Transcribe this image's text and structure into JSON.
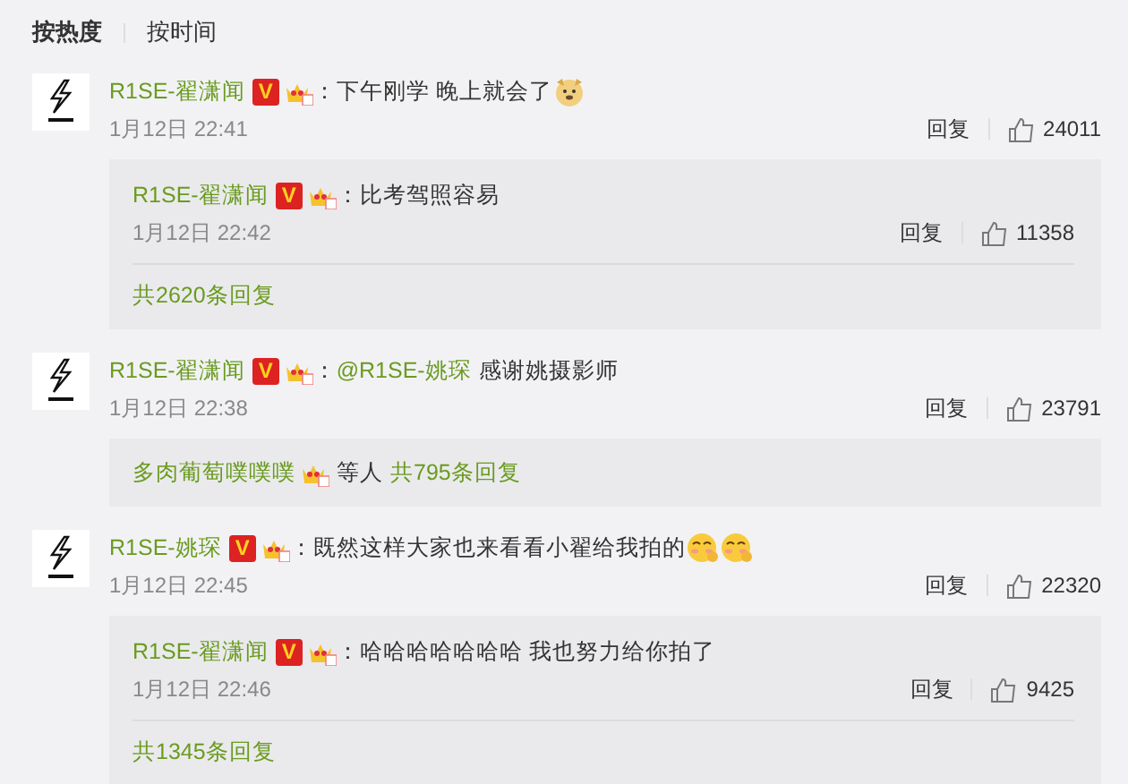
{
  "tabs": [
    {
      "label": "按热度",
      "selected": true
    },
    {
      "label": "按时间",
      "selected": false
    }
  ],
  "comments": [
    {
      "name": "R1SE-翟潇闻",
      "badge": "V",
      "colon": "：",
      "text": "下午刚学 晚上就会了",
      "emojis": [
        {
          "kind": "dog"
        }
      ],
      "time": "1月12日 22:41",
      "reply": "回复",
      "likes": "24011",
      "replies": [
        {
          "name": "R1SE-翟潇闻",
          "badge": "V",
          "colon": "：",
          "text": "比考驾照容易",
          "time": "1月12日 22:42",
          "reply": "回复",
          "likes": "11358"
        }
      ],
      "footer": {
        "kind": "total",
        "total": "共2620条回复"
      }
    },
    {
      "name": "R1SE-翟潇闻",
      "badge": "V",
      "colon": "：",
      "mention": "@R1SE-姚琛",
      "text": "感谢姚摄影师",
      "time": "1月12日 22:38",
      "reply": "回复",
      "likes": "23791",
      "footer": {
        "kind": "summary",
        "user": "多肉葡萄噗噗噗",
        "others": "等人",
        "total": "共795条回复"
      }
    },
    {
      "name": "R1SE-姚琛",
      "badge": "V",
      "colon": "：",
      "text": "既然这样大家也来看看小翟给我拍的",
      "emojis": [
        {
          "kind": "shy"
        },
        {
          "kind": "shy"
        }
      ],
      "time": "1月12日 22:45",
      "reply": "回复",
      "likes": "22320",
      "replies": [
        {
          "name": "R1SE-翟潇闻",
          "badge": "V",
          "colon": "：",
          "text": "哈哈哈哈哈哈哈 我也努力给你拍了",
          "time": "1月12日 22:46",
          "reply": "回复",
          "likes": "9425"
        }
      ],
      "footer": {
        "kind": "total",
        "total": "共1345条回复"
      }
    }
  ]
}
